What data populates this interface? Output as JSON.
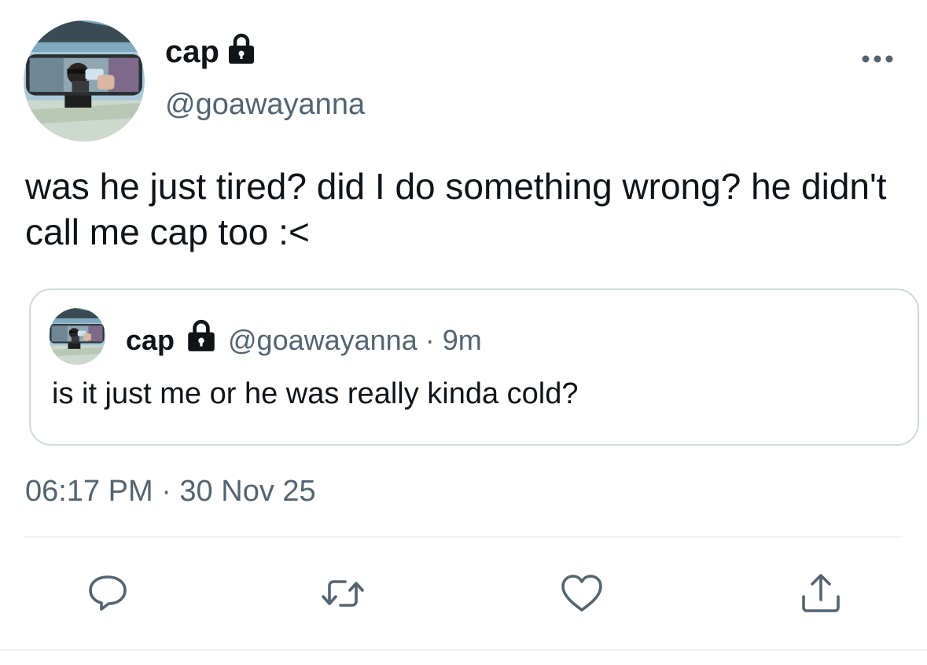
{
  "tweet": {
    "author": {
      "display_name": "cap",
      "handle": "@goawayanna",
      "protected": true
    },
    "text": "was he just tired? did I do something wrong? he didn't call me cap too :<",
    "timestamp": "06:17 PM · 30 Nov 25"
  },
  "quoted_tweet": {
    "display_name": "cap",
    "meta": "@goawayanna · 9m",
    "text": "is it just me or he was really kinda cold?"
  },
  "icons": {
    "more": "more-horizontal-icon",
    "lock": "lock-icon",
    "reply": "reply-icon",
    "retweet": "retweet-icon",
    "like": "heart-icon",
    "share": "share-icon"
  },
  "colors": {
    "primary_text": "#0f1419",
    "secondary_text": "#536471",
    "border": "#cfd9de",
    "divider": "#eff3f4"
  }
}
